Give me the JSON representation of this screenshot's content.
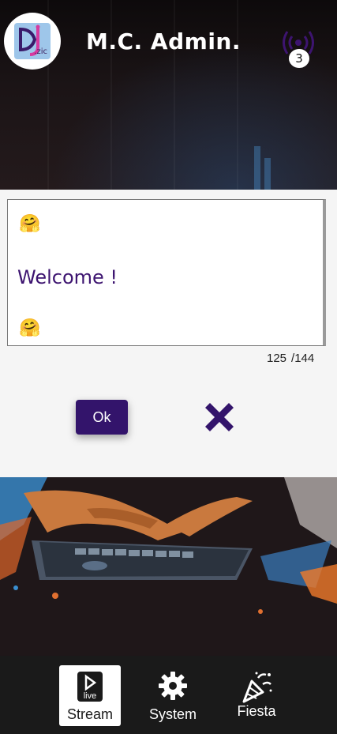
{
  "header": {
    "title": "M.C. Admin.",
    "logo_text": ".zic",
    "live_count": "3"
  },
  "message": {
    "emoji_top": "🤗",
    "text": "Welcome !",
    "emoji_bottom": "🤗",
    "char_count": "125",
    "char_max": "/144"
  },
  "actions": {
    "ok_label": "Ok",
    "close_icon": "close-icon"
  },
  "nav": {
    "items": [
      {
        "label": "Stream",
        "icon": "play-icon",
        "icon_text": "live",
        "active": true
      },
      {
        "label": "System",
        "icon": "gear-icon",
        "active": false
      },
      {
        "label": "Fiesta",
        "icon": "party-popper-icon",
        "active": false
      }
    ]
  },
  "colors": {
    "accent": "#33146b",
    "welcome_text": "#3d1470",
    "panel_bg": "#f5f5f5",
    "nav_bg": "#1a1a1a"
  }
}
